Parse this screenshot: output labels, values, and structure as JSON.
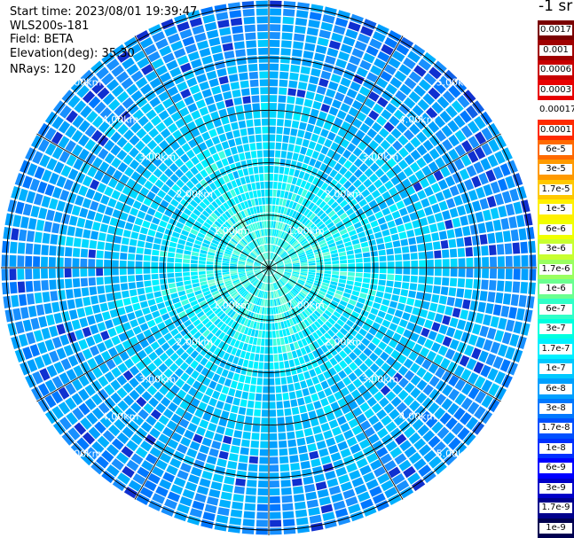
{
  "header": {
    "start_time": "Start time: 2023/08/01 19:39:47",
    "instrument": "WLS200s-181",
    "field": "Field: BETA",
    "elevation": "Elevation(deg): 35.30",
    "nrays": "NRays: 120"
  },
  "colorbar": {
    "unit": "-1 sr",
    "labels": [
      "0.0017",
      "0.001",
      "0.0006",
      "0.0003",
      "0.00017",
      "0.0001",
      "6e-5",
      "3e-5",
      "1.7e-5",
      "1e-5",
      "6e-6",
      "3e-6",
      "1.7e-6",
      "1e-6",
      "6e-7",
      "3e-7",
      "1.7e-7",
      "1e-7",
      "6e-8",
      "3e-8",
      "1.7e-8",
      "1e-8",
      "6e-9",
      "3e-9",
      "1.7e-9",
      "1e-9"
    ],
    "colors": [
      "#7a0000",
      "#a00000",
      "#c80000",
      "#e80000",
      "#ffffff",
      "#ff2a00",
      "#ff6a00",
      "#ff9a00",
      "#ffc800",
      "#fff000",
      "#f0ff00",
      "#c8ff30",
      "#9aff60",
      "#6aff90",
      "#30ffc8",
      "#00ffe0",
      "#00f0ff",
      "#00c8ff",
      "#00a0ff",
      "#0078ff",
      "#0050ff",
      "#0030ff",
      "#0000ff",
      "#0000c8",
      "#00008c",
      "#000050"
    ]
  },
  "chart_data": {
    "type": "heatmap",
    "projection": "polar",
    "field": "BETA",
    "n_rays": 120,
    "range_rings_km": [
      1,
      2,
      3,
      4,
      5
    ],
    "max_range_km": 5.1,
    "range_labels": [
      "1.00km",
      "2.00km",
      "3.00km",
      "4.00km",
      "5.00km"
    ],
    "spokes": 12,
    "inner_value": "1.7e-7",
    "outer_value": "3e-8"
  }
}
